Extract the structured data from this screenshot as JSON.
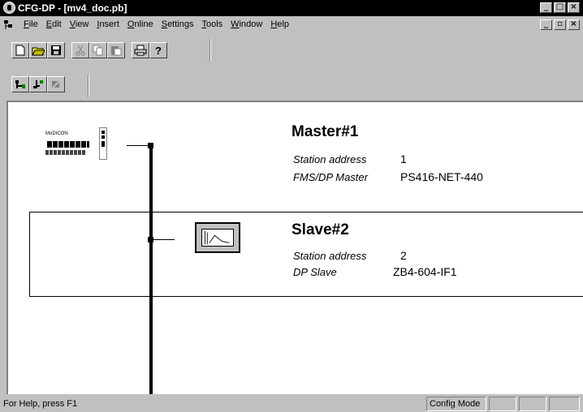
{
  "window": {
    "title": "CFG-DP - [mv4_doc.pb]",
    "minimize": "_",
    "maximize": "□",
    "close": "×"
  },
  "mdi": {
    "minimize": "_",
    "restore": "▫",
    "close": "×"
  },
  "menu": {
    "items": [
      {
        "u": "F",
        "rest": "ile"
      },
      {
        "u": "E",
        "rest": "dit"
      },
      {
        "u": "V",
        "rest": "iew"
      },
      {
        "u": "I",
        "rest": "nsert"
      },
      {
        "u": "O",
        "rest": "nline"
      },
      {
        "u": "S",
        "rest": "ettings"
      },
      {
        "u": "T",
        "rest": "ools"
      },
      {
        "u": "W",
        "rest": "indow"
      },
      {
        "u": "H",
        "rest": "elp"
      }
    ]
  },
  "toolbar": {
    "icons": [
      "new-file-icon",
      "open-folder-icon",
      "save-disk-icon",
      "cut-icon",
      "copy-icon",
      "paste-icon",
      "print-icon",
      "help-question-icon"
    ],
    "help_glyph": "?"
  },
  "toolbar2": {
    "icons": [
      "insert-master-icon",
      "insert-slave-icon",
      "delete-station-icon"
    ]
  },
  "master": {
    "title": "Master#1",
    "logo_text": "MoDICON",
    "address_label": "Station address",
    "address_value": "1",
    "type_label": "FMS/DP Master",
    "type_value": "PS416-NET-440"
  },
  "slave": {
    "title": "Slave#2",
    "address_label": "Station address",
    "address_value": "2",
    "type_label": "DP Slave",
    "type_value": "ZB4-604-IF1"
  },
  "status": {
    "help_text": "For Help, press F1",
    "mode": "Config Mode"
  }
}
